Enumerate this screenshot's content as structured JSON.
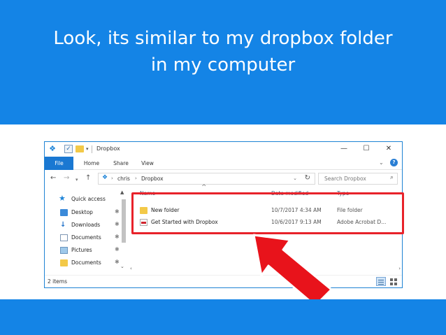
{
  "banner": {
    "title": "Look, its similar to my dropbox folder\nin my computer",
    "color": "#1484e6"
  },
  "window": {
    "title": "Dropbox",
    "controls": {
      "minimize": "—",
      "maximize": "☐",
      "close": "✕"
    },
    "ribbon_tabs": [
      "File",
      "Home",
      "Share",
      "View"
    ],
    "address": {
      "crumbs": [
        "chris",
        "Dropbox"
      ]
    },
    "search": {
      "placeholder": "Search Dropbox"
    },
    "nav_pane": [
      {
        "label": "Quick access",
        "icon": "star-icon"
      },
      {
        "label": "Desktop",
        "icon": "desktop-icon"
      },
      {
        "label": "Downloads",
        "icon": "download-icon"
      },
      {
        "label": "Documents",
        "icon": "documents-icon"
      },
      {
        "label": "Pictures",
        "icon": "pictures-icon"
      },
      {
        "label": "Documents",
        "icon": "folder-icon"
      }
    ],
    "columns": {
      "name": "Name",
      "date": "Date modified",
      "type": "Type"
    },
    "files": [
      {
        "name": "New folder",
        "date": "10/7/2017 4:34 AM",
        "type": "File folder",
        "icon": "folder-icon"
      },
      {
        "name": "Get Started with Dropbox",
        "date": "10/6/2017 9:13 AM",
        "type": "Adobe Acrobat D...",
        "icon": "pdf-icon"
      }
    ],
    "status": {
      "count": "2 items"
    }
  },
  "annotation": {
    "highlight_color": "#e8222a",
    "arrow_color": "#e8131b"
  }
}
